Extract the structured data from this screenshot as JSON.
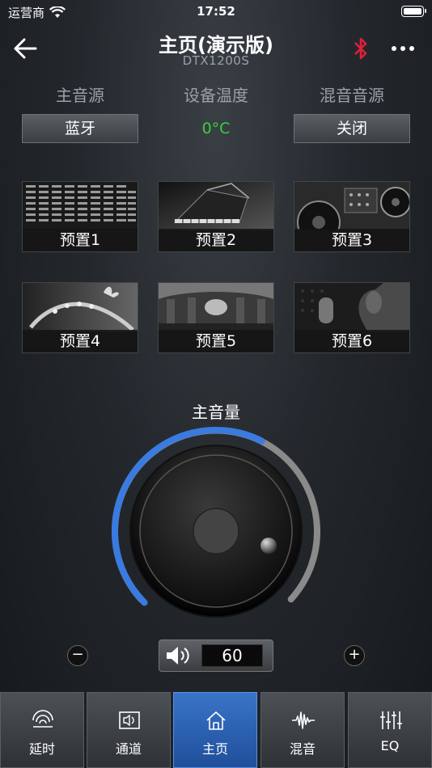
{
  "status_bar": {
    "carrier": "运营商",
    "time": "17:52"
  },
  "nav": {
    "title": "主页(演示版)",
    "subtitle": "DTX1200S"
  },
  "sources": {
    "main_source_label": "主音源",
    "temp_label": "设备温度",
    "mix_source_label": "混音音源",
    "main_source_value": "蓝牙",
    "temp_value": "0°C",
    "mix_source_value": "关闭"
  },
  "presets": [
    {
      "label": "预置1"
    },
    {
      "label": "预置2"
    },
    {
      "label": "预置3"
    },
    {
      "label": "预置4"
    },
    {
      "label": "预置5"
    },
    {
      "label": "预置6"
    }
  ],
  "volume": {
    "title": "主音量",
    "value": "60",
    "level_percent": 60,
    "minus_label": "−",
    "plus_label": "+"
  },
  "colors": {
    "accent": "#3a7be0",
    "temp_green": "#3ad13a",
    "bluetooth_red": "#e0203a"
  },
  "tabs": [
    {
      "label": "延时",
      "icon": "signal-waves-icon"
    },
    {
      "label": "通道",
      "icon": "speaker-channel-icon"
    },
    {
      "label": "主页",
      "icon": "home-icon",
      "active": true
    },
    {
      "label": "混音",
      "icon": "waveform-icon"
    },
    {
      "label": "EQ",
      "icon": "equalizer-sliders-icon"
    }
  ]
}
